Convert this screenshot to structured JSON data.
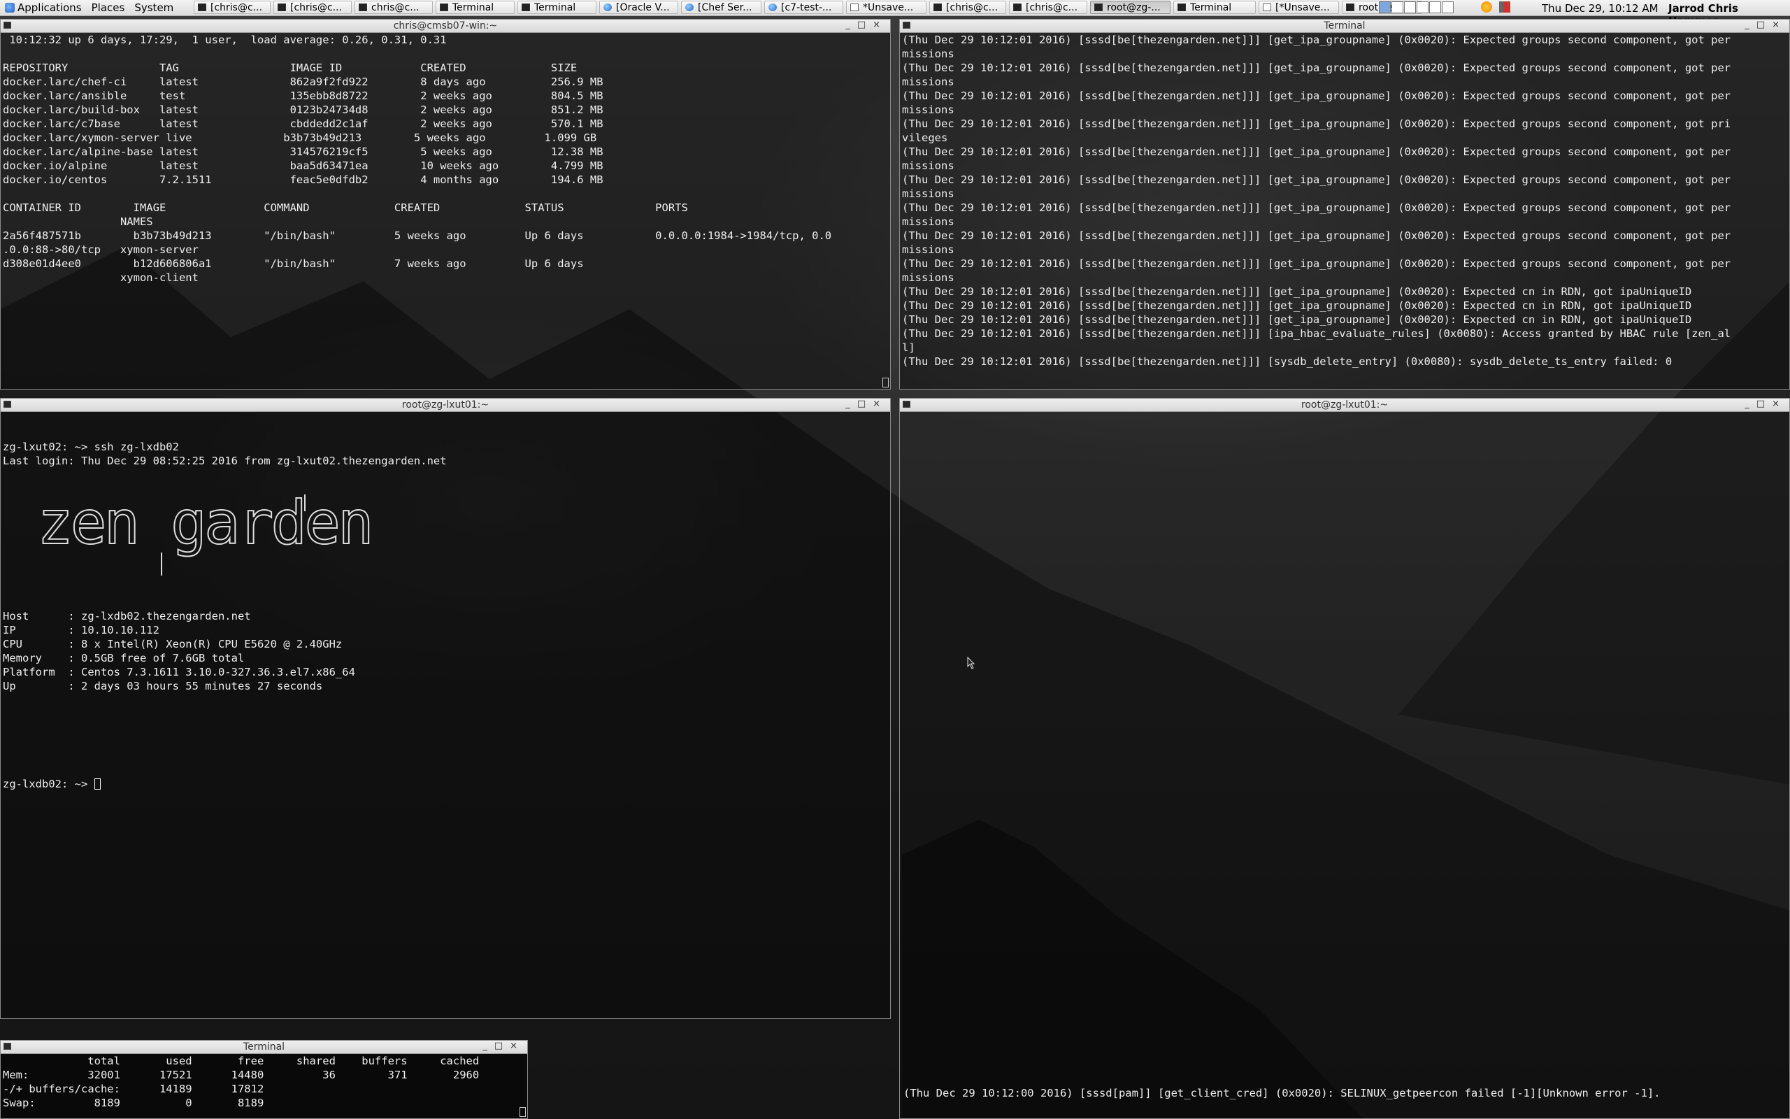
{
  "panel": {
    "menus": [
      "Applications",
      "Places",
      "System"
    ],
    "tasks": [
      {
        "label": "[chris@c...",
        "icon": "terminal-icon",
        "active": false
      },
      {
        "label": "[chris@c...",
        "icon": "terminal-icon",
        "active": false
      },
      {
        "label": "chris@c...",
        "icon": "terminal-icon",
        "active": false
      },
      {
        "label": "Terminal",
        "icon": "terminal-icon",
        "active": false
      },
      {
        "label": "Terminal",
        "icon": "terminal-icon",
        "active": false
      },
      {
        "label": "[Oracle V...",
        "icon": "virtualbox-icon",
        "active": false
      },
      {
        "label": "[Chef Ser...",
        "icon": "browser-icon",
        "active": false
      },
      {
        "label": "[c7-test-...",
        "icon": "browser-icon",
        "active": false
      },
      {
        "label": "*Unsave...",
        "icon": "editor-icon",
        "active": false
      },
      {
        "label": "[chris@c...",
        "icon": "terminal-icon",
        "active": false
      },
      {
        "label": "[chris@c...",
        "icon": "terminal-icon",
        "active": false
      },
      {
        "label": "root@zg-...",
        "icon": "terminal-icon",
        "active": true
      },
      {
        "label": "Terminal",
        "icon": "terminal-icon",
        "active": false
      },
      {
        "label": "[*Unsave...",
        "icon": "editor-icon",
        "active": false
      },
      {
        "label": "root@zg-...",
        "icon": "terminal-icon",
        "active": false
      }
    ],
    "clock": "Thu Dec 29, 10:12 AM",
    "user": "Jarrod Chris Hammer"
  },
  "windows": {
    "docker": {
      "title": "chris@cmsb07-win:~",
      "lines": [
        " 10:12:32 up 6 days, 17:29,  1 user,  load average: 0.26, 0.31, 0.31",
        "",
        "REPOSITORY              TAG                 IMAGE ID            CREATED             SIZE",
        "docker.larc/chef-ci     latest              862a9f2fd922        8 days ago          256.9 MB",
        "docker.larc/ansible     test                135ebb8d8722        2 weeks ago         804.5 MB",
        "docker.larc/build-box   latest              0123b24734d8        2 weeks ago         851.2 MB",
        "docker.larc/c7base      latest              cbddedd2c1af        2 weeks ago         570.1 MB",
        "docker.larc/xymon-server live              b3b73b49d213        5 weeks ago         1.099 GB",
        "docker.larc/alpine-base latest              314576219cf5        5 weeks ago         12.38 MB",
        "docker.io/alpine        latest              baa5d63471ea        10 weeks ago        4.799 MB",
        "docker.io/centos        7.2.1511            feac5e0dfdb2        4 months ago        194.6 MB",
        "",
        "CONTAINER ID        IMAGE               COMMAND             CREATED             STATUS              PORTS",
        "                  NAMES",
        "2a56f487571b        b3b73b49d213        \"/bin/bash\"         5 weeks ago         Up 6 days           0.0.0.0:1984->1984/tcp, 0.0",
        ".0.0:88->80/tcp   xymon-server",
        "d308e01d4ee0        b12d606806a1        \"/bin/bash\"         7 weeks ago         Up 6 days",
        "                  xymon-client"
      ]
    },
    "log": {
      "title": "Terminal",
      "lines": [
        "(Thu Dec 29 10:12:01 2016) [sssd[be[thezengarden.net]]] [get_ipa_groupname] (0x0020): Expected groups second component, got per",
        "missions",
        "(Thu Dec 29 10:12:01 2016) [sssd[be[thezengarden.net]]] [get_ipa_groupname] (0x0020): Expected groups second component, got per",
        "missions",
        "(Thu Dec 29 10:12:01 2016) [sssd[be[thezengarden.net]]] [get_ipa_groupname] (0x0020): Expected groups second component, got per",
        "missions",
        "(Thu Dec 29 10:12:01 2016) [sssd[be[thezengarden.net]]] [get_ipa_groupname] (0x0020): Expected groups second component, got pri",
        "vileges",
        "(Thu Dec 29 10:12:01 2016) [sssd[be[thezengarden.net]]] [get_ipa_groupname] (0x0020): Expected groups second component, got per",
        "missions",
        "(Thu Dec 29 10:12:01 2016) [sssd[be[thezengarden.net]]] [get_ipa_groupname] (0x0020): Expected groups second component, got per",
        "missions",
        "(Thu Dec 29 10:12:01 2016) [sssd[be[thezengarden.net]]] [get_ipa_groupname] (0x0020): Expected groups second component, got per",
        "missions",
        "(Thu Dec 29 10:12:01 2016) [sssd[be[thezengarden.net]]] [get_ipa_groupname] (0x0020): Expected groups second component, got per",
        "missions",
        "(Thu Dec 29 10:12:01 2016) [sssd[be[thezengarden.net]]] [get_ipa_groupname] (0x0020): Expected groups second component, got per",
        "missions",
        "(Thu Dec 29 10:12:01 2016) [sssd[be[thezengarden.net]]] [get_ipa_groupname] (0x0020): Expected cn in RDN, got ipaUniqueID",
        "(Thu Dec 29 10:12:01 2016) [sssd[be[thezengarden.net]]] [get_ipa_groupname] (0x0020): Expected cn in RDN, got ipaUniqueID",
        "(Thu Dec 29 10:12:01 2016) [sssd[be[thezengarden.net]]] [get_ipa_groupname] (0x0020): Expected cn in RDN, got ipaUniqueID",
        "(Thu Dec 29 10:12:01 2016) [sssd[be[thezengarden.net]]] [ipa_hbac_evaluate_rules] (0x0080): Access granted by HBAC rule [zen_al",
        "l]",
        "(Thu Dec 29 10:12:01 2016) [sssd[be[thezengarden.net]]] [sysdb_delete_entry] (0x0080): sysdb_delete_ts_entry failed: 0"
      ]
    },
    "ssh": {
      "title": "root@zg-lxut01:~",
      "command_lines": [
        "zg-lxut02: ~> ssh zg-lxdb02",
        "Last login: Thu Dec 29 08:52:25 2016 from zg-lxut02.thezengarden.net"
      ],
      "ascii_logo": "zen garden",
      "info_lines": [
        "Host      : zg-lxdb02.thezengarden.net",
        "IP        : 10.10.10.112",
        "CPU       : 8 x Intel(R) Xeon(R) CPU E5620 @ 2.40GHz",
        "Memory    : 0.5GB free of 7.6GB total",
        "Platform  : Centos 7.3.1611 3.10.0-327.36.3.el7.x86_64",
        "Up        : 2 days 03 hours 55 minutes 27 seconds"
      ],
      "prompt": "zg-lxdb02: ~> "
    },
    "empty": {
      "title": "root@zg-lxut01:~",
      "bottom_line": "(Thu Dec 29 10:12:00 2016) [sssd[pam]] [get_client_cred] (0x0020): SELINUX_getpeercon failed [-1][Unknown error -1]."
    },
    "free": {
      "title": "Terminal",
      "lines": [
        "             total       used       free     shared    buffers     cached",
        "Mem:         32001      17521      14480         36        371       2960",
        "-/+ buffers/cache:      14189      17812",
        "Swap:         8189          0       8189"
      ]
    }
  }
}
